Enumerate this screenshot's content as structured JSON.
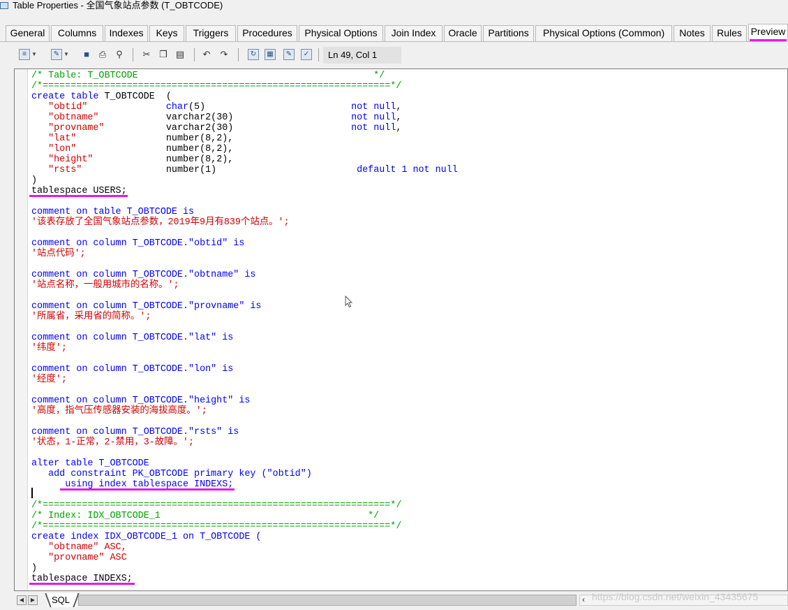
{
  "window": {
    "title": "Table Properties - 全国气象站点参数 (T_OBTCODE)"
  },
  "tabs": [
    {
      "label": "General"
    },
    {
      "label": "Columns"
    },
    {
      "label": "Indexes"
    },
    {
      "label": "Keys"
    },
    {
      "label": "Triggers"
    },
    {
      "label": "Procedures"
    },
    {
      "label": "Physical Options"
    },
    {
      "label": "Join Index"
    },
    {
      "label": "Oracle"
    },
    {
      "label": "Partitions"
    },
    {
      "label": "Physical Options (Common)"
    },
    {
      "label": "Notes"
    },
    {
      "label": "Rules"
    },
    {
      "label": "Preview",
      "active": true
    }
  ],
  "toolbar": {
    "position": "Ln 49, Col 1",
    "icons": [
      "properties-icon",
      "dropdown-icon",
      "edit-icon",
      "dropdown-icon",
      "save-icon",
      "print-icon",
      "find-icon",
      "cut-icon",
      "copy-icon",
      "paste-icon",
      "undo-icon",
      "redo-icon",
      "refresh-icon",
      "view-icon",
      "edit-script-icon",
      "check-icon"
    ]
  },
  "editor": {
    "comment_lines": [
      "/* Table: T_OBTCODE                                          */",
      "/*==============================================================*/",
      "/*==============================================================*/",
      "/* Index: IDX_OBTCODE_1                                     */",
      "/*==============================================================*/"
    ],
    "create_table": {
      "kw": "create table",
      "name": "T_OBTCODE",
      "columns": [
        {
          "name": "\"obtid\"",
          "type": "char",
          "size": "(5)",
          "constraint": "not null",
          "default": ""
        },
        {
          "name": "\"obtname\"",
          "type": "varchar2",
          "size": "(30)",
          "constraint": "not null",
          "default": ""
        },
        {
          "name": "\"provname\"",
          "type": "varchar2",
          "size": "(30)",
          "constraint": "not null",
          "default": ""
        },
        {
          "name": "\"lat\"",
          "type": "number",
          "size": "(8,2)",
          "constraint": "",
          "default": ""
        },
        {
          "name": "\"lon\"",
          "type": "number",
          "size": "(8,2)",
          "constraint": "",
          "default": ""
        },
        {
          "name": "\"height\"",
          "type": "number",
          "size": "(8,2)",
          "constraint": "",
          "default": ""
        },
        {
          "name": "\"rsts\"",
          "type": "number",
          "size": "(1)",
          "constraint": "not null",
          "default": "default 1"
        }
      ],
      "tablespace": "tablespace USERS;"
    },
    "comments": [
      {
        "target": "comment on table T_OBTCODE is",
        "text": "'该表存放了全国气象站点参数，2019年9月有839个站点。';"
      },
      {
        "target": "comment on column T_OBTCODE.\"obtid\" is",
        "text": "'站点代码';"
      },
      {
        "target": "comment on column T_OBTCODE.\"obtname\" is",
        "text": "'站点名称，一般用城市的名称。';"
      },
      {
        "target": "comment on column T_OBTCODE.\"provname\" is",
        "text": "'所属省，采用省的简称。';"
      },
      {
        "target": "comment on column T_OBTCODE.\"lat\" is",
        "text": "'纬度';"
      },
      {
        "target": "comment on column T_OBTCODE.\"lon\" is",
        "text": "'经度';"
      },
      {
        "target": "comment on column T_OBTCODE.\"height\" is",
        "text": "'高度，指气压传感器安装的海拔高度。';"
      },
      {
        "target": "comment on column T_OBTCODE.\"rsts\" is",
        "text": "'状态，1-正常，2-禁用，3-故障。';"
      }
    ],
    "alter": {
      "line1": "alter table T_OBTCODE",
      "line2": "add constraint PK_OBTCODE primary key (\"obtid\")",
      "line3": "using index tablespace INDEXS;"
    },
    "create_index": {
      "line": "create index IDX_OBTCODE_1 on T_OBTCODE (",
      "cols": [
        "\"obtname\" ASC,",
        "\"provname\" ASC"
      ],
      "tablespace": "tablespace INDEXS;"
    }
  },
  "bottom": {
    "sql_tab": "SQL",
    "watermark": "https://blog.csdn.net/weixin_43435675"
  },
  "colors": {
    "comment": "#00a000",
    "keyword": "#0000ff",
    "string": "#d00000",
    "highlight": "#e619e6"
  }
}
